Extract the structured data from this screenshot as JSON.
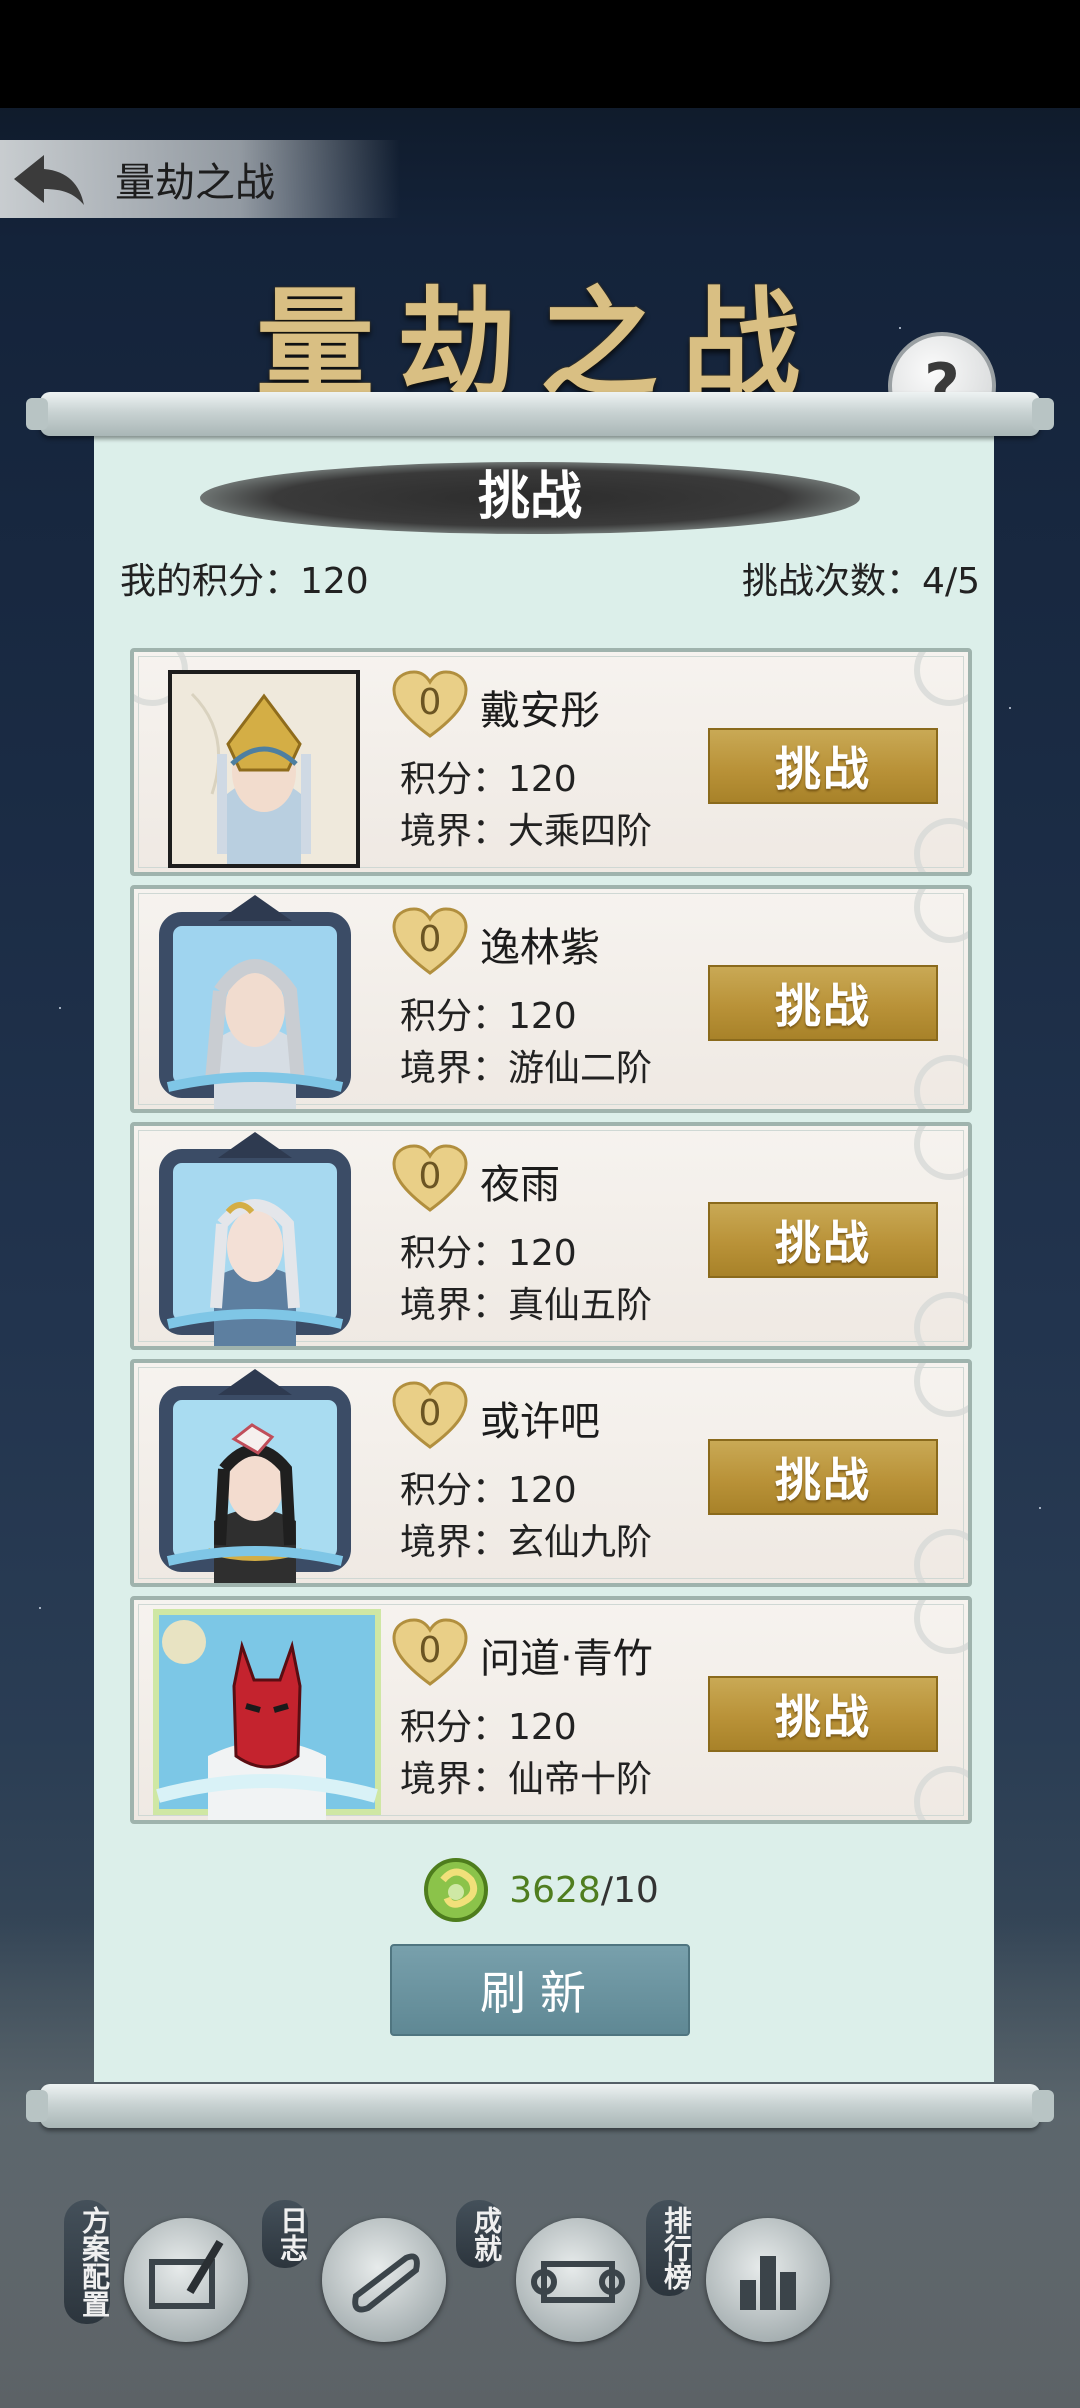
{
  "header": {
    "title": "量劫之战",
    "banner_title": "量劫之战",
    "help_label": "?"
  },
  "panel": {
    "title": "挑战",
    "my_score_label": "我的积分：120",
    "challenge_count_label": "挑战次数：4/5"
  },
  "opponents": [
    {
      "likes": "0",
      "name": "戴安彤",
      "score": "积分：120",
      "realm": "境界：大乘四阶",
      "button": "挑战"
    },
    {
      "likes": "0",
      "name": "逸林紫",
      "score": "积分：120",
      "realm": "境界：游仙二阶",
      "button": "挑战"
    },
    {
      "likes": "0",
      "name": "夜雨",
      "score": "积分：120",
      "realm": "境界：真仙五阶",
      "button": "挑战"
    },
    {
      "likes": "0",
      "name": "或许吧",
      "score": "积分：120",
      "realm": "境界：玄仙九阶",
      "button": "挑战"
    },
    {
      "likes": "0",
      "name": "问道·青竹",
      "score": "积分：120",
      "realm": "境界：仙帝十阶",
      "button": "挑战"
    }
  ],
  "currency": {
    "have": "3628",
    "cost": "/10",
    "icon": "jade-coin-icon"
  },
  "refresh_label": "刷新",
  "bottom_nav": [
    {
      "label": "方案配置",
      "icon": "scroll-brush-icon"
    },
    {
      "label": "日志",
      "icon": "scroll-roll-icon"
    },
    {
      "label": "成就",
      "icon": "open-scroll-icon"
    },
    {
      "label": "排行榜",
      "icon": "bar-chart-icon"
    }
  ],
  "colors": {
    "accent_gold": "#b99238",
    "panel_bg": "#dcefea",
    "refresh_btn": "#6b929e",
    "currency_green": "#4f7d1f"
  }
}
